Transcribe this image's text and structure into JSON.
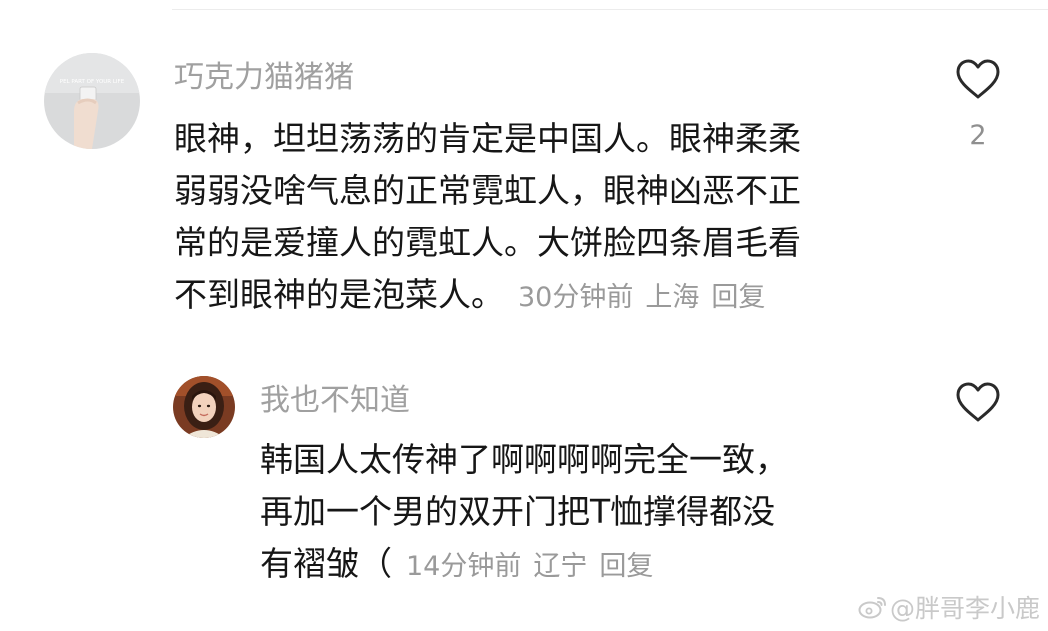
{
  "comment": {
    "username": "巧克力猫猪猪",
    "text_lines": [
      "眼神，坦坦荡荡的肯定是中国人。眼神柔柔",
      "弱弱没啥气息的正常霓虹人，眼神凶恶不正",
      "常的是爱撞人的霓虹人。大饼脸四条眉毛看",
      "不到眼神的是泡菜人。"
    ],
    "time": "30分钟前",
    "location": "上海",
    "reply_label": "回复",
    "like_count": "2",
    "avatar_caption": "PEL PART OF YOUR LIFE",
    "avatar_icon": "hand-holding-cup-avatar"
  },
  "reply": {
    "username": "我也不知道",
    "text_lines": [
      "韩国人太传神了啊啊啊啊完全一致，",
      "再加一个男的双开门把T恤撑得都没",
      "有褶皱（"
    ],
    "time": "14分钟前",
    "location": "辽宁",
    "reply_label": "回复",
    "avatar_icon": "girl-portrait-avatar"
  },
  "watermark": {
    "text": "@胖哥李小鹿",
    "icon": "weibo-logo-icon"
  },
  "colors": {
    "username": "#a0a0a0",
    "body_text": "#161616",
    "meta": "#9a9a9a",
    "watermark": "#c9c9c9"
  }
}
